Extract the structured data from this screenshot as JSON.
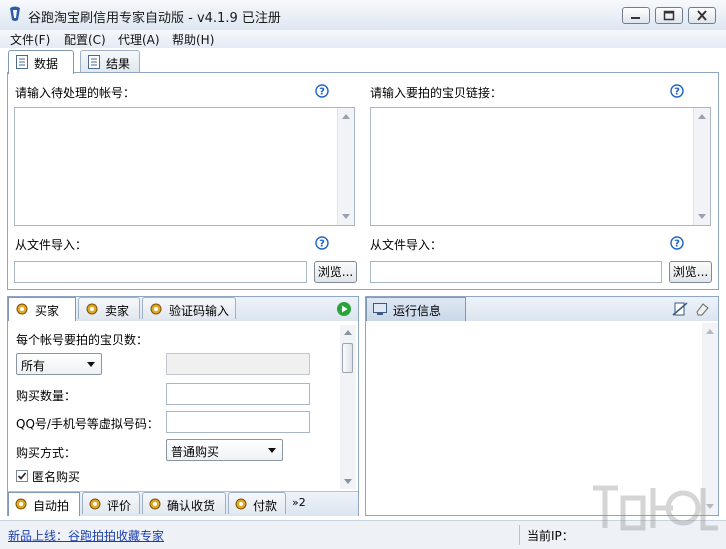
{
  "window": {
    "title": "谷跑淘宝刷信用专家自动版 - v4.1.9 已注册"
  },
  "menu": [
    "文件(F)",
    "配置(C)",
    "代理(A)",
    "帮助(H)"
  ],
  "top_tabs": [
    {
      "label": "数据",
      "active": true
    },
    {
      "label": "结果",
      "active": false
    }
  ],
  "data_panel": {
    "accounts_label": "请输入待处理的帐号：",
    "links_label": "请输入要拍的宝贝链接：",
    "import_label_left": "从文件导入：",
    "import_label_right": "从文件导入：",
    "browse_label": "浏览..."
  },
  "left_tabs": [
    {
      "label": "买家",
      "active": true
    },
    {
      "label": "卖家",
      "active": false
    },
    {
      "label": "验证码输入",
      "active": false
    }
  ],
  "buyer_form": {
    "per_account_label": "每个帐号要拍的宝贝数：",
    "per_account_value": "所有",
    "quantity_label": "购买数量：",
    "qq_label": "QQ号/手机号等虚拟号码：",
    "method_label": "购买方式：",
    "method_value": "普通购买",
    "anonymous_label": "匿名购买",
    "anonymous_checked": true
  },
  "bottom_tabs": [
    {
      "label": "自动拍",
      "active": true
    },
    {
      "label": "评价",
      "active": false
    },
    {
      "label": "确认收货",
      "active": false
    },
    {
      "label": "付款",
      "active": false
    }
  ],
  "more_tabs": "»2",
  "log_panel": {
    "title": "运行信息"
  },
  "status": {
    "new_product": "新品上线：谷跑拍拍收藏专家",
    "ip_label": "当前IP："
  },
  "colors": {
    "accent": "#8fa6c2",
    "help_blue": "#1e63c9",
    "link": "#1a3fb3"
  }
}
